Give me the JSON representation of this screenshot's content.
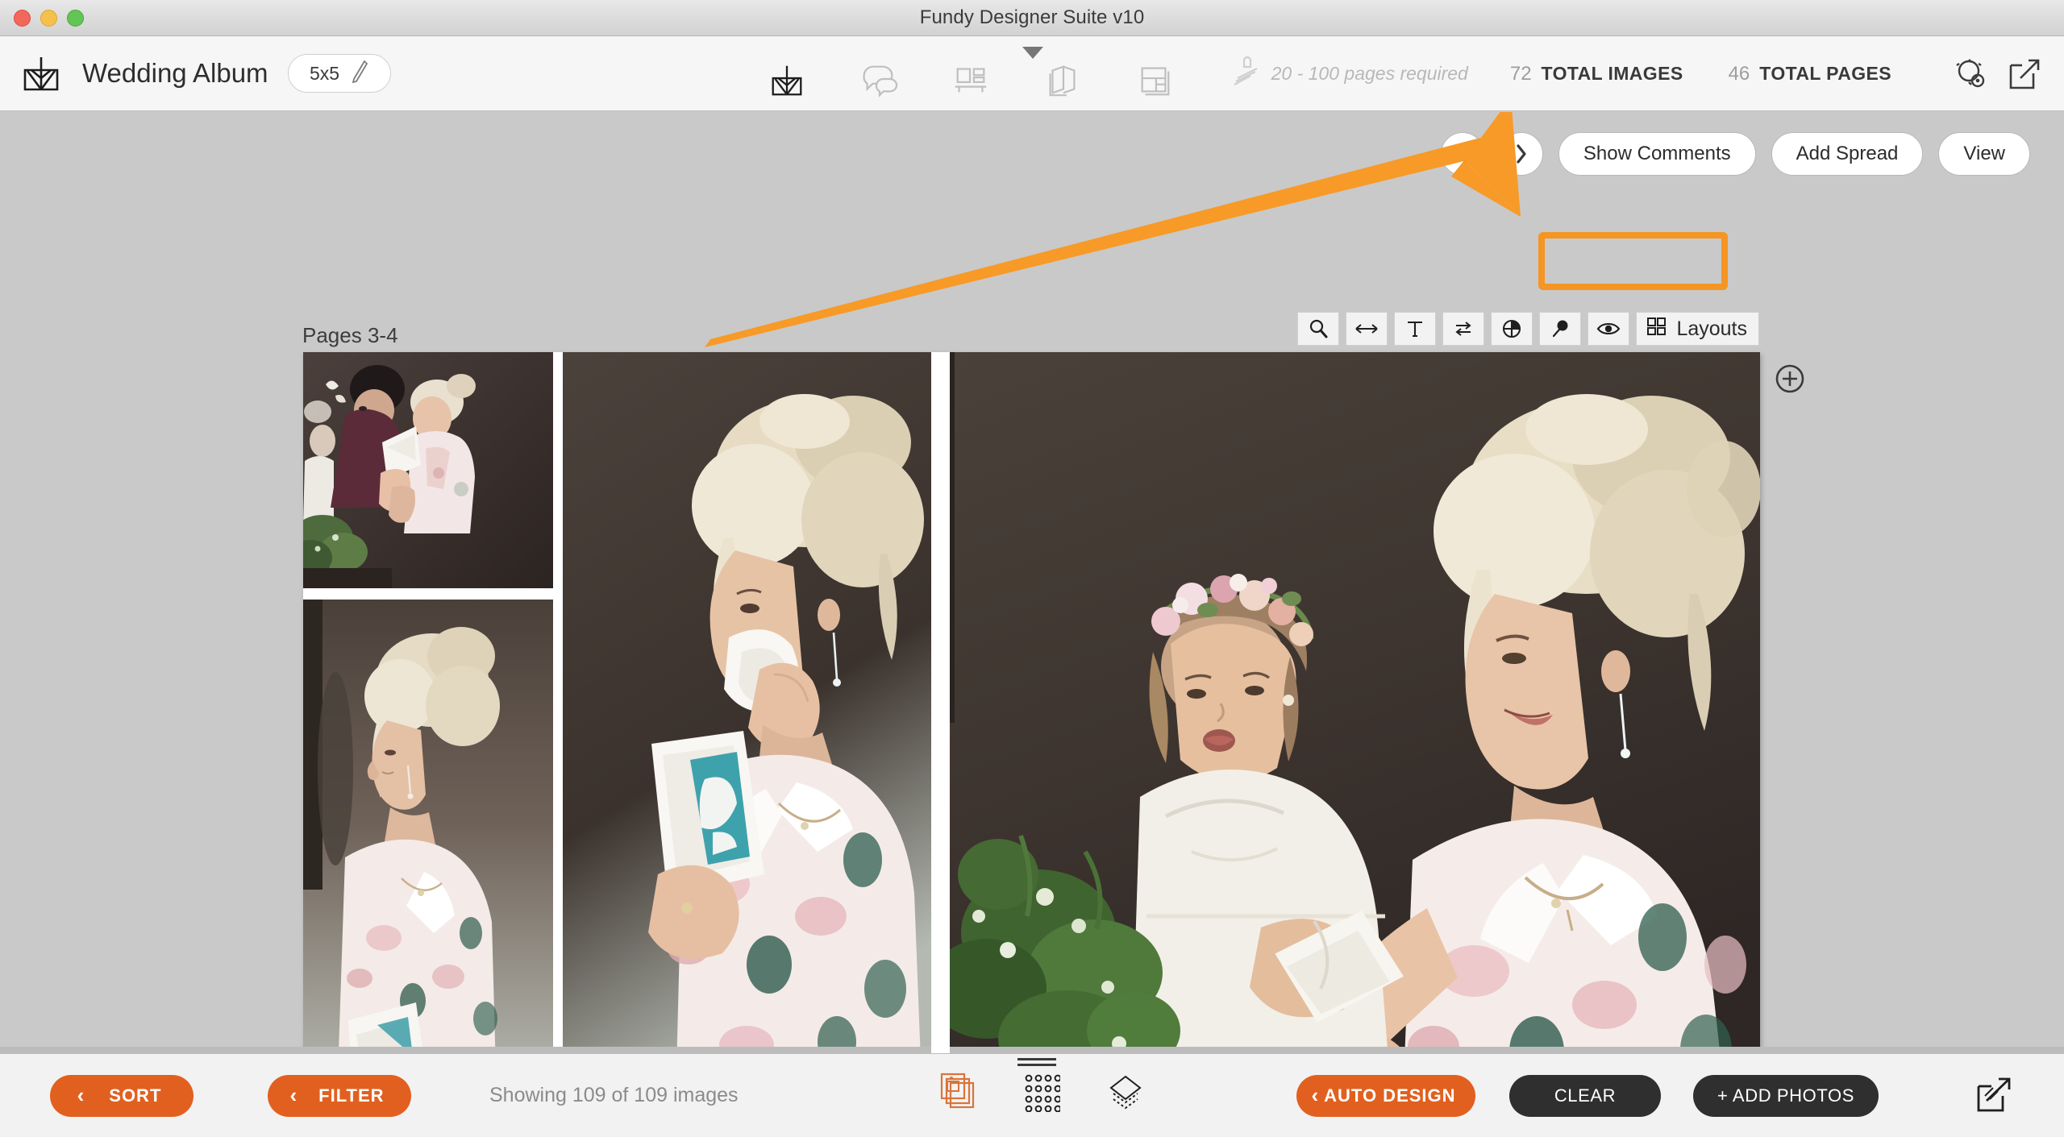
{
  "window": {
    "title": "Fundy Designer Suite v10",
    "traffic_lights": [
      "close",
      "minimize",
      "zoom"
    ]
  },
  "header": {
    "logo_icon": "fundy-album-logo-icon",
    "album_title": "Wedding Album",
    "size_value": "5x5",
    "size_edit_icon": "pencil-icon",
    "center_icons": [
      {
        "name": "album-design-icon",
        "active": true
      },
      {
        "name": "comments-bubble-icon",
        "active": false
      },
      {
        "name": "wall-art-icon",
        "active": false
      },
      {
        "name": "book-pages-icon",
        "active": false
      },
      {
        "name": "layout-grid-icon",
        "active": false
      }
    ],
    "caret_icon": "caret-down-icon",
    "requirement_icon": "press-stamp-icon",
    "requirement_text": "20 - 100 pages required",
    "stats": [
      {
        "number": "72",
        "label": "TOTAL IMAGES"
      },
      {
        "number": "46",
        "label": "TOTAL PAGES"
      }
    ],
    "right_icons": [
      "settings-gear-icon",
      "share-export-icon"
    ]
  },
  "actionbar": {
    "prev_label": "‹",
    "next_label": "›",
    "show_comments_label": "Show Comments",
    "add_spread_label": "Add Spread",
    "view_label": "View",
    "highlight_color": "#f59524",
    "highlighted_button": "Show Comments"
  },
  "spread": {
    "pages_label": "Pages 3-4",
    "add_spread_plus_icon": "plus-circle-icon",
    "tools": [
      {
        "name": "zoom-magnifier-icon",
        "glyph": "search"
      },
      {
        "name": "resize-width-icon",
        "glyph": "arrows-h"
      },
      {
        "name": "text-tool-icon",
        "glyph": "T"
      },
      {
        "name": "swap-images-icon",
        "glyph": "swap"
      },
      {
        "name": "contrast-icon",
        "glyph": "pie"
      },
      {
        "name": "pin-icon",
        "glyph": "pin"
      },
      {
        "name": "preview-eye-icon",
        "glyph": "eye"
      }
    ],
    "layouts_label": "Layouts",
    "layouts_icon": "layouts-grid-icon",
    "photos": [
      {
        "name": "photo-cell-bride-with-mother",
        "page": "left",
        "slot": "top-left"
      },
      {
        "name": "photo-cell-bride-profile",
        "page": "left",
        "slot": "bottom-left"
      },
      {
        "name": "photo-cell-bride-reading-letter",
        "page": "left",
        "slot": "right-column"
      },
      {
        "name": "photo-cell-bride-and-flower-girl",
        "page": "right",
        "slot": "full"
      }
    ]
  },
  "bottombar": {
    "sort_label": "SORT",
    "filter_label": "FILTER",
    "chevron_glyph": "‹",
    "showing_text": "Showing 109 of 109 images",
    "mode_icons": [
      {
        "name": "image-stack-icon",
        "active": true
      },
      {
        "name": "grid-dots-icon",
        "active": false
      },
      {
        "name": "layers-icon",
        "active": false
      }
    ],
    "drag_handle_icon": "drag-handle-icon",
    "auto_design_label": "AUTO DESIGN",
    "clear_label": "CLEAR",
    "add_photos_label": "+ ADD PHOTOS",
    "export_icon": "export-arrow-icon"
  },
  "colors": {
    "accent_orange": "#e2601f",
    "highlight_orange": "#f59524",
    "dark_button": "#2f2f2f",
    "canvas_gray": "#c9c9c9",
    "header_gray": "#f6f6f6"
  }
}
